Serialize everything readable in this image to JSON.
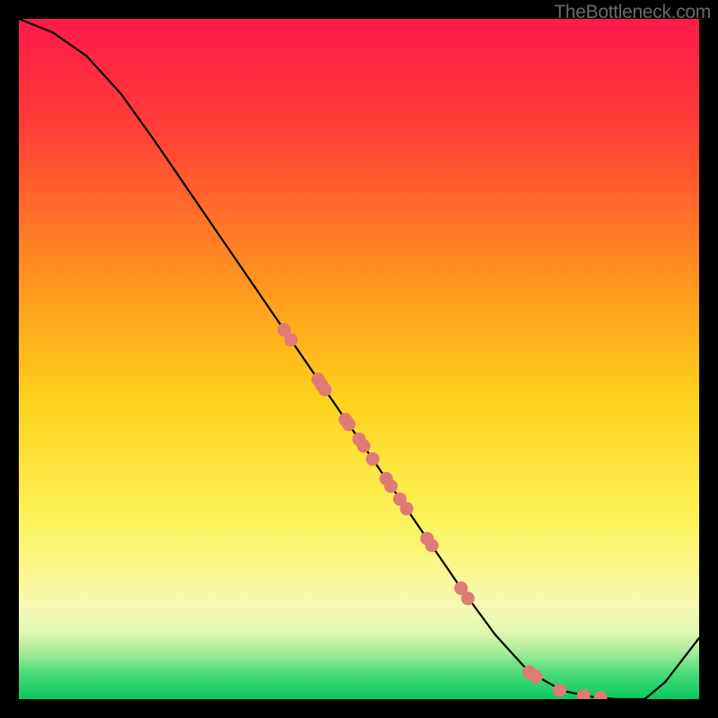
{
  "watermark": "TheBottleneck.com",
  "chart_data": {
    "type": "line",
    "title": "",
    "xlabel": "",
    "ylabel": "",
    "xlim": [
      0,
      100
    ],
    "ylim": [
      0,
      100
    ],
    "grid": false,
    "legend": false,
    "series": [
      {
        "name": "bottleneck-curve",
        "x": [
          0,
          5,
          10,
          15,
          20,
          25,
          30,
          35,
          40,
          45,
          50,
          55,
          60,
          65,
          70,
          75,
          80,
          85,
          88,
          92,
          95,
          100
        ],
        "y": [
          100,
          98,
          94.5,
          89,
          82,
          74.7,
          67.4,
          60.1,
          52.8,
          45.5,
          38.2,
          30.9,
          23.6,
          16.3,
          9.5,
          4,
          1.2,
          0.2,
          0,
          0,
          2.5,
          9
        ]
      }
    ],
    "points": {
      "name": "highlight-dots",
      "x": [
        39,
        40,
        44,
        44.5,
        45,
        48,
        48.5,
        50,
        50.7,
        52,
        54,
        54.7,
        56,
        57,
        60,
        60.7,
        65,
        66,
        75,
        76,
        79.5,
        83,
        85.5
      ],
      "y": [
        54.3,
        52.8,
        47,
        46.2,
        45.5,
        41.1,
        40.4,
        38.2,
        37.2,
        35.3,
        32.4,
        31.3,
        29.4,
        28,
        23.6,
        22.6,
        16.3,
        14.8,
        4.0,
        3.3,
        1.3,
        0.5,
        0.2
      ]
    },
    "colors": {
      "line": "#000000",
      "dots": "#e07a74",
      "gradient_top": "#ff1a4b",
      "gradient_mid": "#fcf35c",
      "gradient_bottom": "#07c85f"
    }
  }
}
